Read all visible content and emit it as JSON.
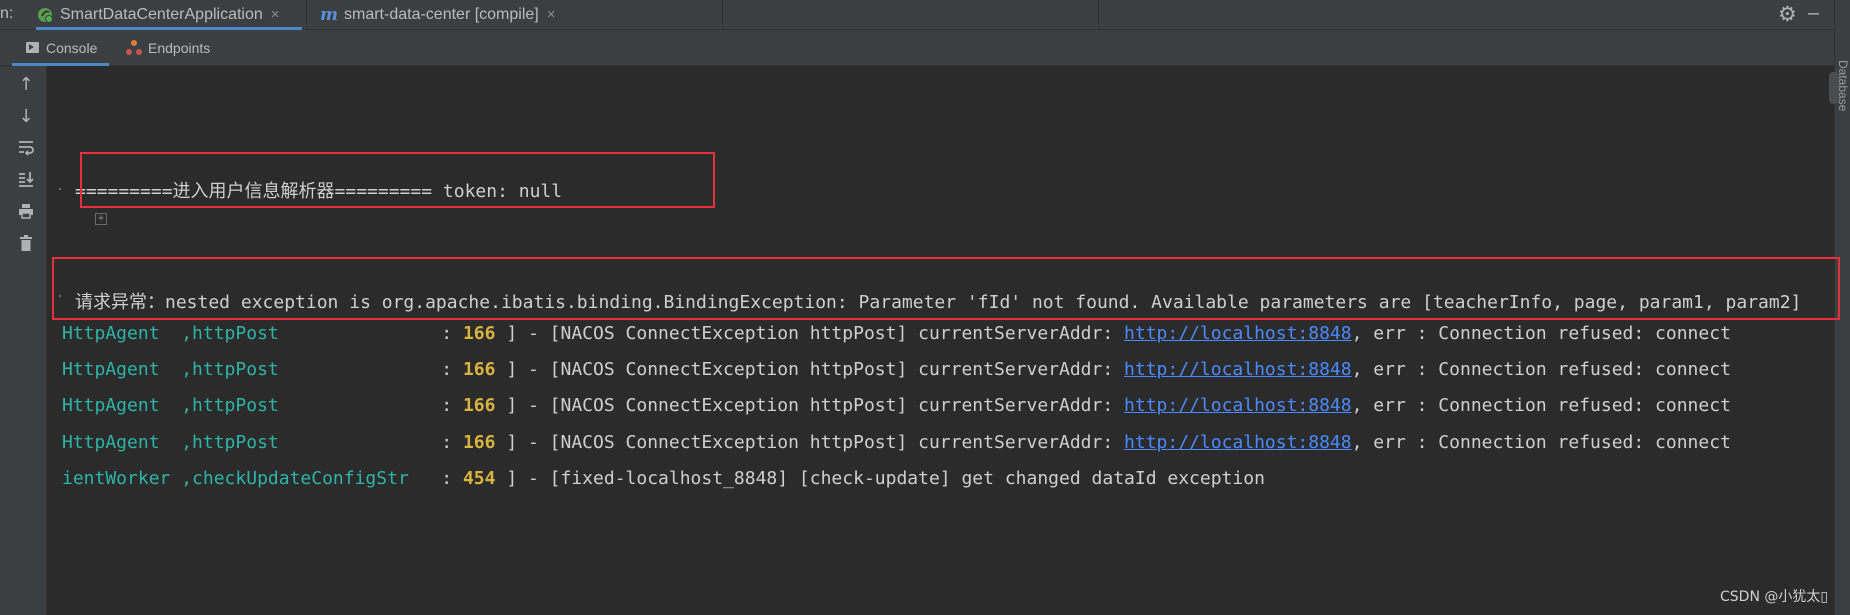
{
  "run_bar": {
    "prefix": "n:",
    "tabs": [
      {
        "label": "SmartDataCenterApplication",
        "icon": "spring-boot-run-icon"
      },
      {
        "label": "smart-data-center [compile]",
        "icon": "maven-m-icon"
      }
    ],
    "close_symbol": "×",
    "gear_icon": "gear-icon",
    "minimize_icon": "minimize-icon"
  },
  "side_panel_label": "Database",
  "sub_tabs": {
    "console": "Console",
    "endpoints": "Endpoints"
  },
  "left_tools": [
    "up-arrow-icon",
    "down-arrow-icon",
    "soft-wrap-icon",
    "scroll-to-end-icon",
    "print-icon",
    "trash-icon"
  ],
  "console": {
    "line1": "=========进入用户信息解析器========= token: null",
    "line2": "请求异常：nested exception is org.apache.ibatis.binding.BindingException: Parameter 'fId' not found. Available parameters are [teacherInfo, page, param1, param2]",
    "log_lines": [
      {
        "cls": "HttpAgent  ,httpPost            ",
        "num": "166",
        "msg_pre": " ] - [NACOS ConnectException httpPost] currentServerAddr: ",
        "url": "http://localhost:8848",
        "msg_post": ", err : Connection refused: connect"
      },
      {
        "cls": "HttpAgent  ,httpPost            ",
        "num": "166",
        "msg_pre": " ] - [NACOS ConnectException httpPost] currentServerAddr: ",
        "url": "http://localhost:8848",
        "msg_post": ", err : Connection refused: connect"
      },
      {
        "cls": "HttpAgent  ,httpPost            ",
        "num": "166",
        "msg_pre": " ] - [NACOS ConnectException httpPost] currentServerAddr: ",
        "url": "http://localhost:8848",
        "msg_post": ", err : Connection refused: connect"
      },
      {
        "cls": "HttpAgent  ,httpPost            ",
        "num": "166",
        "msg_pre": " ] - [NACOS ConnectException httpPost] currentServerAddr: ",
        "url": "http://localhost:8848",
        "msg_post": ", err : Connection refused: connect"
      },
      {
        "cls": "ientWorker ,checkUpdateConfigStr",
        "num": "454",
        "msg_pre": " ] - [fixed-localhost_8848] [check-update] get changed dataId exception",
        "url": "",
        "msg_post": ""
      }
    ],
    "colon": "   : "
  },
  "watermark": "CSDN @小犹太▯",
  "colors": {
    "highlight_box": "#e5323a",
    "class_text": "#2cb5a6",
    "line_number": "#d9b33f",
    "link": "#4a8cff",
    "tab_underline": "#4a88c7"
  }
}
